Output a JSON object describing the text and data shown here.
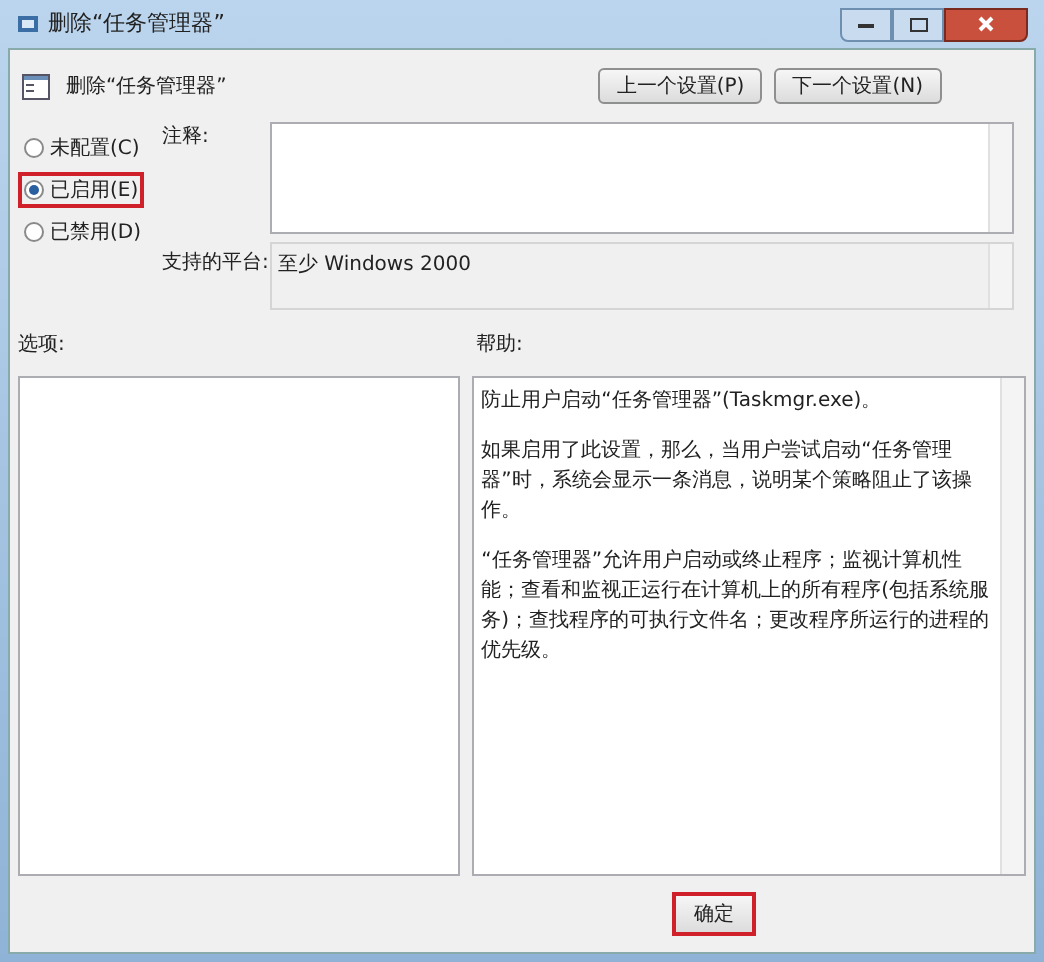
{
  "window": {
    "title": "删除“任务管理器”"
  },
  "header": {
    "title": "删除“任务管理器”"
  },
  "nav_buttons": [
    {
      "label": "上一个设置(P)"
    },
    {
      "label": "下一个设置(N)"
    }
  ],
  "options": [
    {
      "label": "未配置(C)",
      "selected": false,
      "highlighted": false
    },
    {
      "label": "已启用(E)",
      "selected": true,
      "highlighted": true
    },
    {
      "label": "已禁用(D)",
      "selected": false,
      "highlighted": false
    }
  ],
  "comment": {
    "label": "注释:"
  },
  "platform": {
    "label": "支持的平台:",
    "value": "至少 Windows 2000"
  },
  "options_panel": {
    "label": "选项:"
  },
  "help_panel": {
    "label": "帮助:",
    "paragraphs": [
      "防止用户启动“任务管理器”(Taskmgr.exe)。",
      "如果启用了此设置，那么，当用户尝试启动“任务管理器”时，系统会显示一条消息，说明某个策略阻止了该操作。",
      "“任务管理器”允许用户启动或终止程序；监视计算机性能；查看和监视正运行在计算机上的所有程序(包括系统服务)；查找程序的可执行文件名；更改程序所运行的进程的优先级。"
    ]
  },
  "footer_buttons": [
    {
      "label": "确定",
      "highlighted": true
    }
  ]
}
